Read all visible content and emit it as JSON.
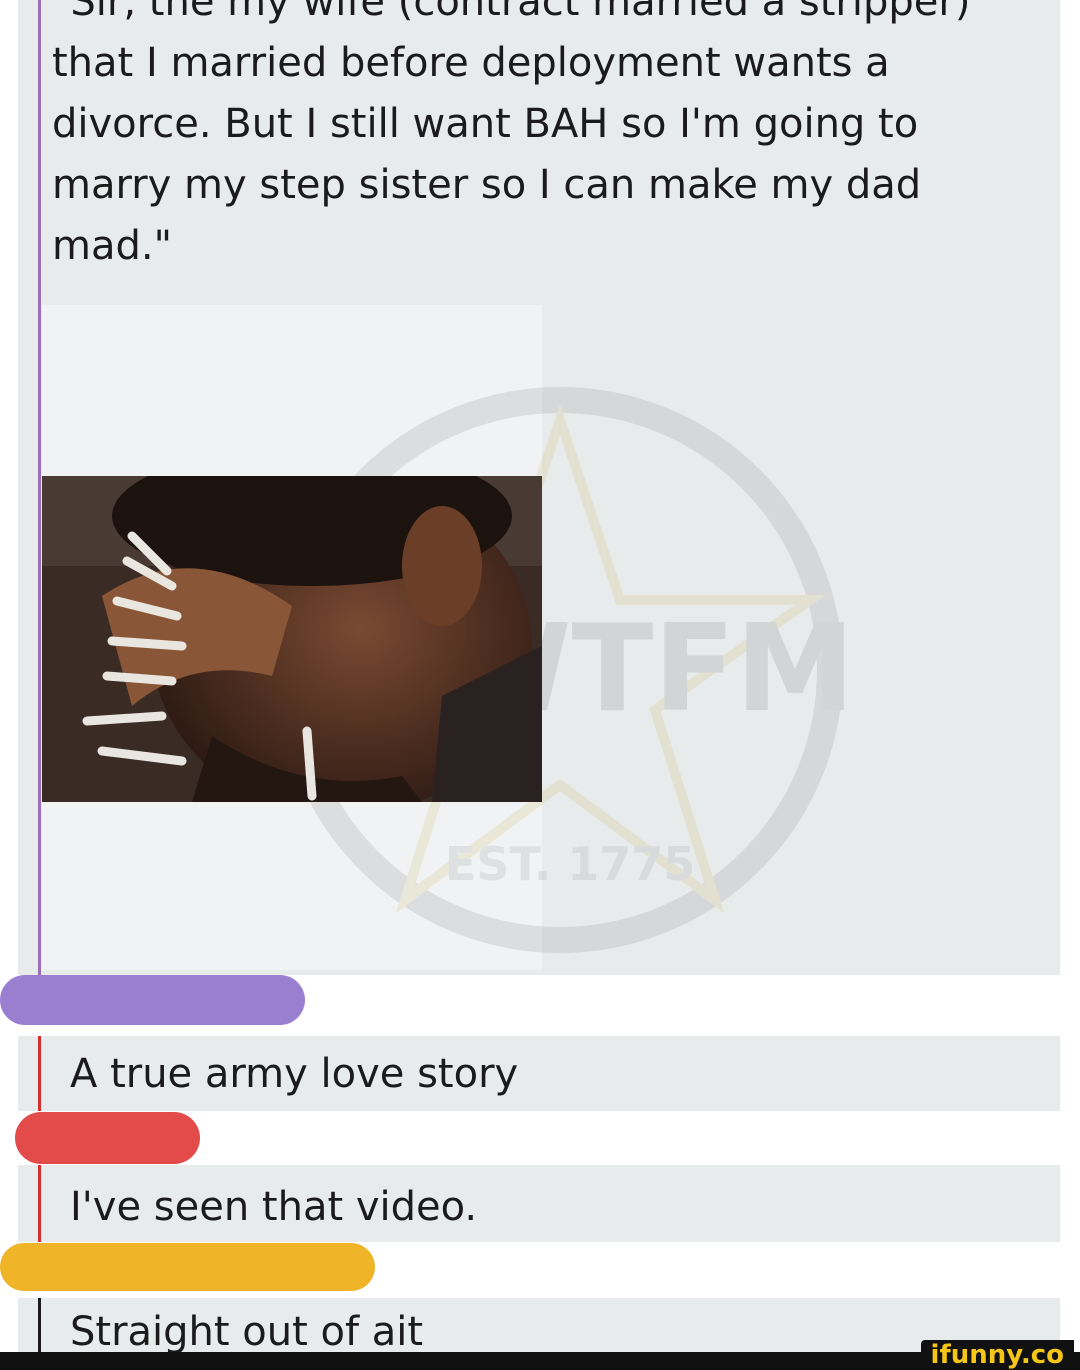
{
  "post": {
    "text": "\"Sir, the my wife (contract married a stripper)\nthat I married before deployment wants a\ndivorce. But I still want BAH so I'm going to\nmarry my step sister so I can make my dad\nmad.\""
  },
  "watermark": {
    "brand": "SAWTFM",
    "est": "EST. 1775"
  },
  "photo": {
    "icon": "man-smoking-many-cigarettes-photo"
  },
  "replies": [
    {
      "text": "A true army love story",
      "bar_color": "#d32f2f"
    },
    {
      "text": "I've seen that video.",
      "bar_color": "#d32f2f"
    },
    {
      "text": "Straight out of ait",
      "bar_color": "#1b1b1b"
    }
  ],
  "redactions": {
    "purple": "#9a7fd1",
    "red": "#e34a4a",
    "yellow": "#f0b429"
  },
  "footer": {
    "logo": "ifunny.co"
  }
}
